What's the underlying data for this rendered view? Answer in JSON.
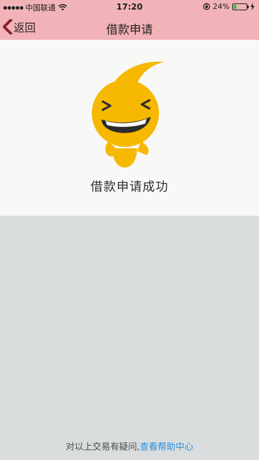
{
  "status_bar": {
    "carrier": "中国联通",
    "time": "17:20",
    "battery_percent": "24%",
    "battery_level": 0.24,
    "icons": [
      "signal-dots-icon",
      "wifi-icon",
      "rotation-lock-icon",
      "battery-icon",
      "charging-bolt-icon"
    ]
  },
  "nav": {
    "back_label": "返回",
    "title": "借款申请"
  },
  "result": {
    "message": "借款申请成功"
  },
  "footer": {
    "prefix": "对以上交易有疑问,",
    "link_label": "查看帮助中心"
  },
  "colors": {
    "nav_background": "#f2b3b8",
    "back_arrow": "#8a1f2c",
    "mascot_yellow": "#f6b800",
    "link": "#2a8fe0",
    "page_background": "#d9dddd"
  }
}
